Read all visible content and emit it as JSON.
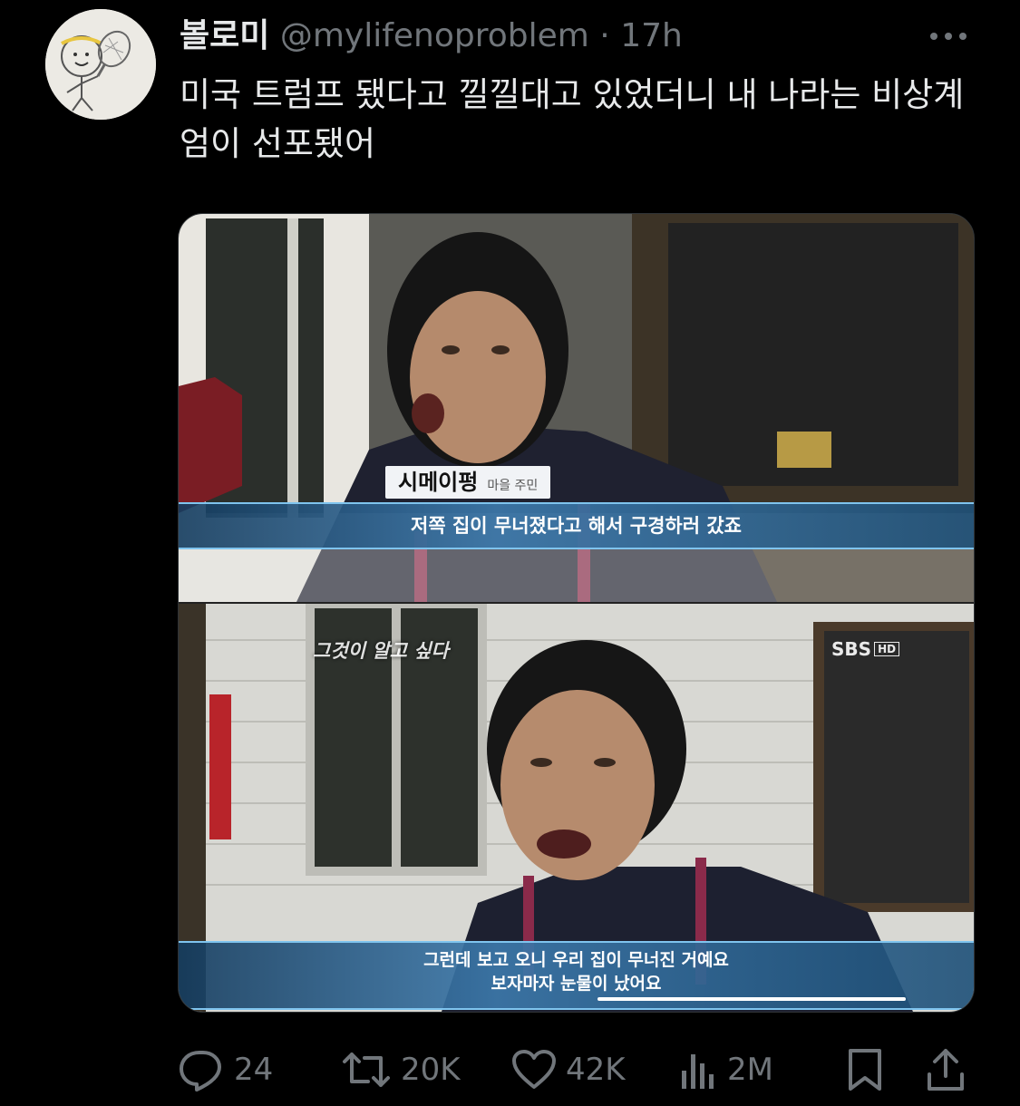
{
  "tweet": {
    "author_name": "볼로미",
    "handle": "@mylifenoproblem",
    "separator": "·",
    "time": "17h",
    "text": "미국 트럼프 됐다고 낄낄대고 있었더니 내 나라는 비상계엄이 선포됐어"
  },
  "media": {
    "top_frame": {
      "speaker_name": "시메이펑",
      "speaker_role": "마을 주민",
      "subtitle": "저쪽 집이 무너졌다고 해서 구경하러 갔죠"
    },
    "bottom_frame": {
      "show_logo": "그것이 알고 싶다",
      "broadcaster": "SBS",
      "broadcaster_badge": "HD",
      "subtitle_line1": "그런데 보고 오니 우리 집이 무너진 거예요",
      "subtitle_line2": "보자마자 눈물이 났어요"
    }
  },
  "actions": {
    "replies": "24",
    "reposts": "20K",
    "likes": "42K",
    "views": "2M"
  },
  "icons": {
    "reply": "reply-icon",
    "repost": "repost-icon",
    "like": "like-icon",
    "views": "views-icon",
    "bookmark": "bookmark-icon",
    "share": "share-icon",
    "more": "more-icon"
  },
  "colors": {
    "background": "#000000",
    "text": "#e7e9ea",
    "secondary": "#71767b",
    "subtitle_bar": "#3c78aa"
  }
}
